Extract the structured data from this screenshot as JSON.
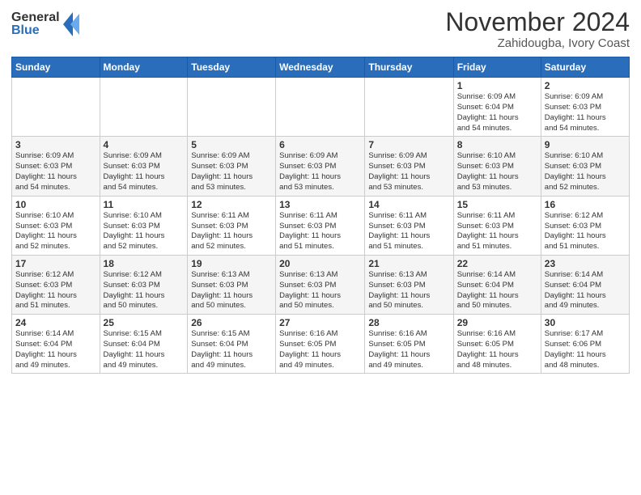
{
  "header": {
    "logo_general": "General",
    "logo_blue": "Blue",
    "title": "November 2024",
    "subtitle": "Zahidougba, Ivory Coast"
  },
  "weekdays": [
    "Sunday",
    "Monday",
    "Tuesday",
    "Wednesday",
    "Thursday",
    "Friday",
    "Saturday"
  ],
  "weeks": [
    [
      {
        "day": "",
        "info": ""
      },
      {
        "day": "",
        "info": ""
      },
      {
        "day": "",
        "info": ""
      },
      {
        "day": "",
        "info": ""
      },
      {
        "day": "",
        "info": ""
      },
      {
        "day": "1",
        "info": "Sunrise: 6:09 AM\nSunset: 6:04 PM\nDaylight: 11 hours\nand 54 minutes."
      },
      {
        "day": "2",
        "info": "Sunrise: 6:09 AM\nSunset: 6:03 PM\nDaylight: 11 hours\nand 54 minutes."
      }
    ],
    [
      {
        "day": "3",
        "info": "Sunrise: 6:09 AM\nSunset: 6:03 PM\nDaylight: 11 hours\nand 54 minutes."
      },
      {
        "day": "4",
        "info": "Sunrise: 6:09 AM\nSunset: 6:03 PM\nDaylight: 11 hours\nand 54 minutes."
      },
      {
        "day": "5",
        "info": "Sunrise: 6:09 AM\nSunset: 6:03 PM\nDaylight: 11 hours\nand 53 minutes."
      },
      {
        "day": "6",
        "info": "Sunrise: 6:09 AM\nSunset: 6:03 PM\nDaylight: 11 hours\nand 53 minutes."
      },
      {
        "day": "7",
        "info": "Sunrise: 6:09 AM\nSunset: 6:03 PM\nDaylight: 11 hours\nand 53 minutes."
      },
      {
        "day": "8",
        "info": "Sunrise: 6:10 AM\nSunset: 6:03 PM\nDaylight: 11 hours\nand 53 minutes."
      },
      {
        "day": "9",
        "info": "Sunrise: 6:10 AM\nSunset: 6:03 PM\nDaylight: 11 hours\nand 52 minutes."
      }
    ],
    [
      {
        "day": "10",
        "info": "Sunrise: 6:10 AM\nSunset: 6:03 PM\nDaylight: 11 hours\nand 52 minutes."
      },
      {
        "day": "11",
        "info": "Sunrise: 6:10 AM\nSunset: 6:03 PM\nDaylight: 11 hours\nand 52 minutes."
      },
      {
        "day": "12",
        "info": "Sunrise: 6:11 AM\nSunset: 6:03 PM\nDaylight: 11 hours\nand 52 minutes."
      },
      {
        "day": "13",
        "info": "Sunrise: 6:11 AM\nSunset: 6:03 PM\nDaylight: 11 hours\nand 51 minutes."
      },
      {
        "day": "14",
        "info": "Sunrise: 6:11 AM\nSunset: 6:03 PM\nDaylight: 11 hours\nand 51 minutes."
      },
      {
        "day": "15",
        "info": "Sunrise: 6:11 AM\nSunset: 6:03 PM\nDaylight: 11 hours\nand 51 minutes."
      },
      {
        "day": "16",
        "info": "Sunrise: 6:12 AM\nSunset: 6:03 PM\nDaylight: 11 hours\nand 51 minutes."
      }
    ],
    [
      {
        "day": "17",
        "info": "Sunrise: 6:12 AM\nSunset: 6:03 PM\nDaylight: 11 hours\nand 51 minutes."
      },
      {
        "day": "18",
        "info": "Sunrise: 6:12 AM\nSunset: 6:03 PM\nDaylight: 11 hours\nand 50 minutes."
      },
      {
        "day": "19",
        "info": "Sunrise: 6:13 AM\nSunset: 6:03 PM\nDaylight: 11 hours\nand 50 minutes."
      },
      {
        "day": "20",
        "info": "Sunrise: 6:13 AM\nSunset: 6:03 PM\nDaylight: 11 hours\nand 50 minutes."
      },
      {
        "day": "21",
        "info": "Sunrise: 6:13 AM\nSunset: 6:03 PM\nDaylight: 11 hours\nand 50 minutes."
      },
      {
        "day": "22",
        "info": "Sunrise: 6:14 AM\nSunset: 6:04 PM\nDaylight: 11 hours\nand 50 minutes."
      },
      {
        "day": "23",
        "info": "Sunrise: 6:14 AM\nSunset: 6:04 PM\nDaylight: 11 hours\nand 49 minutes."
      }
    ],
    [
      {
        "day": "24",
        "info": "Sunrise: 6:14 AM\nSunset: 6:04 PM\nDaylight: 11 hours\nand 49 minutes."
      },
      {
        "day": "25",
        "info": "Sunrise: 6:15 AM\nSunset: 6:04 PM\nDaylight: 11 hours\nand 49 minutes."
      },
      {
        "day": "26",
        "info": "Sunrise: 6:15 AM\nSunset: 6:04 PM\nDaylight: 11 hours\nand 49 minutes."
      },
      {
        "day": "27",
        "info": "Sunrise: 6:16 AM\nSunset: 6:05 PM\nDaylight: 11 hours\nand 49 minutes."
      },
      {
        "day": "28",
        "info": "Sunrise: 6:16 AM\nSunset: 6:05 PM\nDaylight: 11 hours\nand 49 minutes."
      },
      {
        "day": "29",
        "info": "Sunrise: 6:16 AM\nSunset: 6:05 PM\nDaylight: 11 hours\nand 48 minutes."
      },
      {
        "day": "30",
        "info": "Sunrise: 6:17 AM\nSunset: 6:06 PM\nDaylight: 11 hours\nand 48 minutes."
      }
    ]
  ]
}
